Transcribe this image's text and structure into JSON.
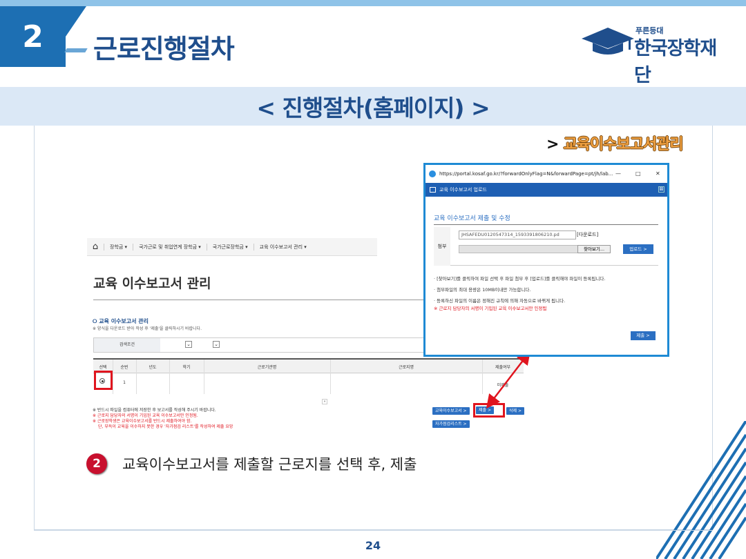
{
  "header": {
    "chapter_number": "2",
    "title": "근로진행절차",
    "logo_sub": "푸른등대",
    "logo_main": "한국장학재단"
  },
  "section_title": "< 진행절차(홈페이지) >",
  "breadcrumb": {
    "prefix": ">",
    "label": "교육이수보고서관리"
  },
  "site": {
    "nav": {
      "home_icon": "home-icon",
      "items": [
        "장학금",
        "국가근로 및 취업연계 장학금",
        "국가근로장학금",
        "교육 이수보고서 관리"
      ]
    },
    "page_heading": "교육 이수보고서 관리",
    "subsection": "교육 이수보고서 관리",
    "subsection_note": "※ 양식을 다운로드 받아 작성 후 '제출'을 클릭하시기 바랍니다.",
    "search_label": "검색조건",
    "table": {
      "headers": [
        "선택",
        "순번",
        "년도",
        "학기",
        "근로기관명",
        "근로지명",
        "제출여부"
      ],
      "rows": [
        {
          "seq": "1",
          "status": "미제출"
        }
      ]
    },
    "pager": "»",
    "notes": [
      {
        "text": "※ 반드시 파일을 컴퓨터에 저장한 후 보고서를 작성해 주시기 바랍니다.",
        "red": false
      },
      {
        "text": "※ 근로지 담당자의 서명이 기입된 교육 이수보고서만 인정됨.",
        "red": true
      },
      {
        "text": "※ 근로장학생은 교육이수보고서를 반드시 제출하여야 함.",
        "red": true
      },
      {
        "text": "단, 부득이 교육을 이수하지 못한 경우 '자가점검 리스트'를 작성하여 제출 요망",
        "red": true
      }
    ],
    "buttons": {
      "report": "교육이수보고서 >",
      "submit": "제출 >",
      "delete": "삭제 >",
      "checklist": "자가점검리스트 >"
    }
  },
  "popup": {
    "url": "https://portal.kosaf.go.kr/?forwardOnlyFlag=N&forwardPage=pt/jh/lab...",
    "window_controls": [
      "—",
      "□",
      "✕"
    ],
    "title": "교육 이수보고서 업로드",
    "close_glyph": "⊠",
    "form_title": "교육 이수보고서 제출 및 수정",
    "attach_label": "첨부",
    "file_name": "JHSAFEDU0120547314_1593391806210.pd",
    "download_label": "[다운로드]",
    "browse_label": "찾아보기...",
    "upload_label": "업로드 >",
    "info": [
      {
        "text": "· [찾아보기]를 클릭하여 파일 선택 후 파일 첨부 후 [업로드]를 클릭해야 파일이 등록됩니다.",
        "red": false
      },
      {
        "text": "· 첨부파일의 최대 용량은 10MB이내만 가능합니다.",
        "red": false
      },
      {
        "text": "· 등록하신 파일의 이름은 정해진 규칙에 의해 자동으로 바뀌게 됩니다.",
        "red": false
      },
      {
        "text": "※ 근로지 담당자의 서명이 기입된 교육 이수보고서만 인정됨",
        "red": true
      }
    ],
    "submit_label": "제출 >"
  },
  "step": {
    "number": "2",
    "text": "교육이수보고서를 제출할 근로지를 선택 후, 제출"
  },
  "page_number": "24",
  "colors": {
    "brand_blue": "#1f4e8c",
    "accent_blue": "#1d6fb3",
    "highlight_red": "#e0141e",
    "band": "#dbe8f6"
  }
}
